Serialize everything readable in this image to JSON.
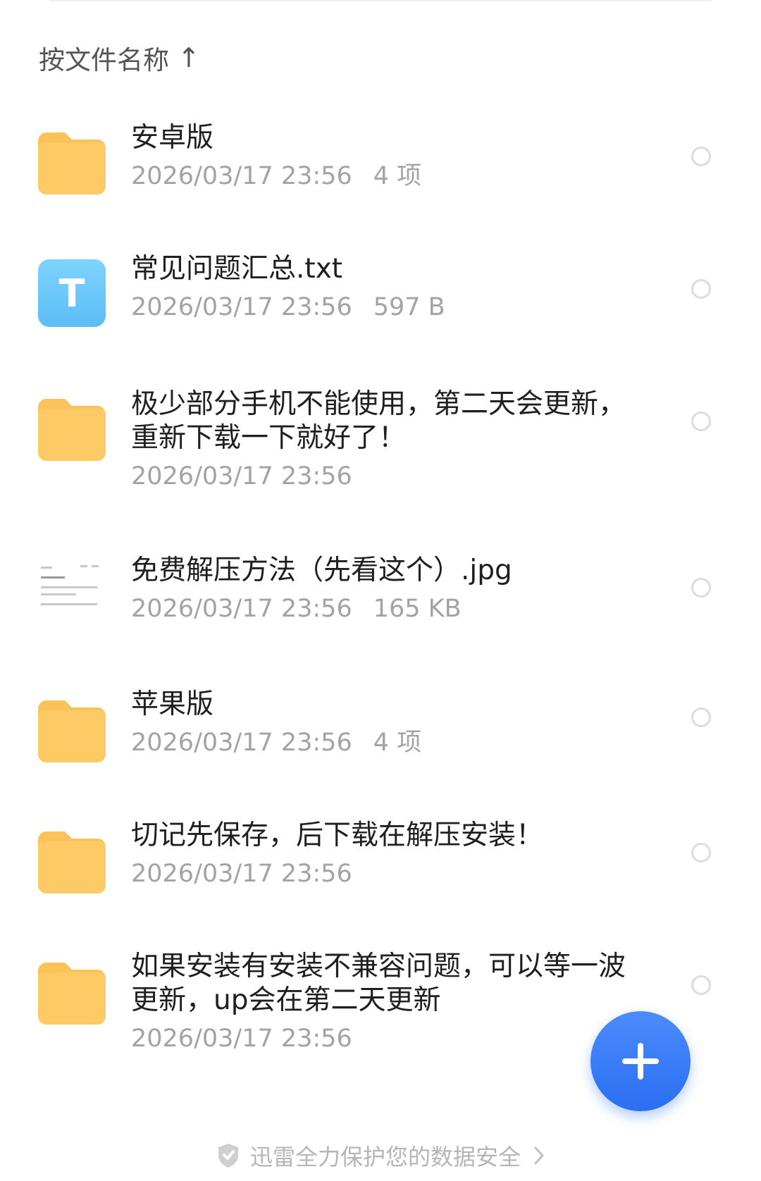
{
  "sort": {
    "label": "按文件名称",
    "arrow": "↑"
  },
  "colors": {
    "folder": "#fcc25a",
    "txt_icon": "#6ec8fb",
    "fab": "#3a7cf7",
    "meta_text": "#a3a3a3"
  },
  "files": [
    {
      "name": "安卓版",
      "date": "2026/03/17 23:56",
      "info": "4 项",
      "icon": "folder-icon"
    },
    {
      "name": "常见问题汇总.txt",
      "date": "2026/03/17 23:56",
      "info": "597 B",
      "icon": "txt-file-icon",
      "icon_letter": "T"
    },
    {
      "name": "极少部分手机不能使用，第二天会更新，重新下载一下就好了！",
      "date": "2026/03/17 23:56",
      "info": "",
      "icon": "folder-icon"
    },
    {
      "name": "免费解压方法（先看这个）.jpg",
      "date": "2026/03/17 23:56",
      "info": "165 KB",
      "icon": "image-thumbnail-icon"
    },
    {
      "name": "苹果版",
      "date": "2026/03/17 23:56",
      "info": "4 项",
      "icon": "folder-icon"
    },
    {
      "name": "切记先保存，后下载在解压安装！",
      "date": "2026/03/17 23:56",
      "info": "",
      "icon": "folder-icon"
    },
    {
      "name": "如果安装有安装不兼容问题，可以等一波更新，up会在第二天更新",
      "date": "2026/03/17 23:56",
      "info": "",
      "icon": "folder-icon"
    }
  ],
  "fab": {
    "icon": "plus-icon"
  },
  "footer": {
    "text": "迅雷全力保护您的数据安全",
    "icon": "shield-icon",
    "chevron": "chevron-right-icon"
  }
}
